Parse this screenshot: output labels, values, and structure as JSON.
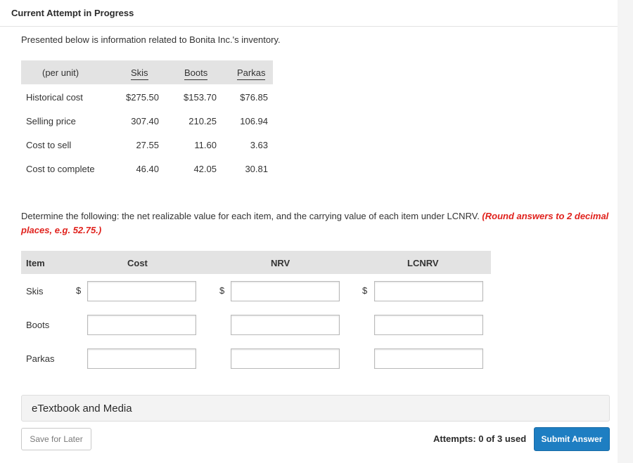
{
  "header": {
    "title": "Current Attempt in Progress"
  },
  "intro": "Presented below is information related to Bonita Inc.'s inventory.",
  "info_table": {
    "headers": {
      "unit": "(per unit)",
      "skis": "Skis",
      "boots": "Boots",
      "parkas": "Parkas"
    },
    "rows": [
      {
        "label": "Historical cost",
        "skis": "$275.50",
        "boots": "$153.70",
        "parkas": "$76.85"
      },
      {
        "label": "Selling price",
        "skis": "307.40",
        "boots": "210.25",
        "parkas": "106.94"
      },
      {
        "label": "Cost to sell",
        "skis": "27.55",
        "boots": "11.60",
        "parkas": "3.63"
      },
      {
        "label": "Cost to complete",
        "skis": "46.40",
        "boots": "42.05",
        "parkas": "30.81"
      }
    ]
  },
  "instructions": {
    "text": "Determine the following: the net realizable value for each item, and the carrying value of each item under LCNRV. ",
    "note": "(Round answers to 2 decimal places, e.g. 52.75.)"
  },
  "answer_table": {
    "headers": {
      "item": "Item",
      "cost": "Cost",
      "nrv": "NRV",
      "lcnrv": "LCNRV"
    },
    "currency_symbol": "$",
    "rows": [
      {
        "item": "Skis",
        "cost": "",
        "nrv": "",
        "lcnrv": ""
      },
      {
        "item": "Boots",
        "cost": "",
        "nrv": "",
        "lcnrv": ""
      },
      {
        "item": "Parkas",
        "cost": "",
        "nrv": "",
        "lcnrv": ""
      }
    ]
  },
  "etextbook": {
    "label": "eTextbook and Media"
  },
  "footer": {
    "save_label": "Save for Later",
    "attempts_text": "Attempts: 0 of 3 used",
    "submit_label": "Submit Answer"
  },
  "colors": {
    "submit_button": "#1e7ec2",
    "note_red": "#e0211c",
    "header_gray": "#e3e3e3"
  }
}
